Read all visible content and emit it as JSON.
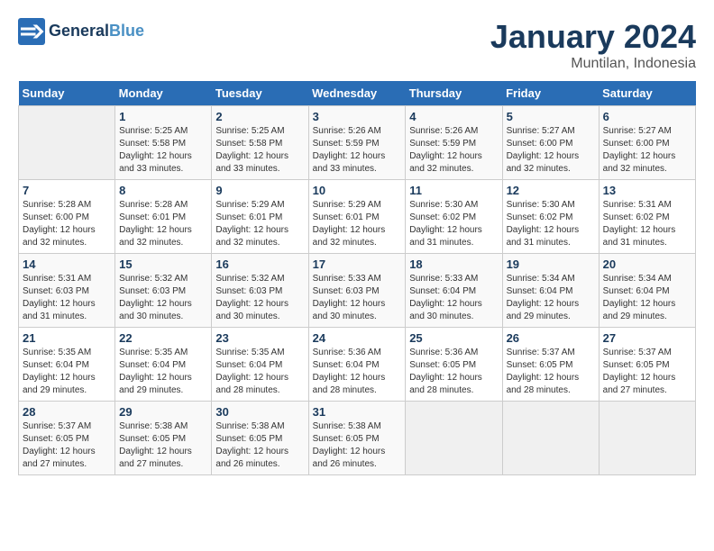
{
  "header": {
    "logo_line1": "General",
    "logo_line2": "Blue",
    "month_title": "January 2024",
    "location": "Muntilan, Indonesia"
  },
  "days_of_week": [
    "Sunday",
    "Monday",
    "Tuesday",
    "Wednesday",
    "Thursday",
    "Friday",
    "Saturday"
  ],
  "weeks": [
    [
      {
        "day": "",
        "sunrise": "",
        "sunset": "",
        "daylight": ""
      },
      {
        "day": "1",
        "sunrise": "5:25 AM",
        "sunset": "5:58 PM",
        "daylight": "12 hours and 33 minutes."
      },
      {
        "day": "2",
        "sunrise": "5:25 AM",
        "sunset": "5:58 PM",
        "daylight": "12 hours and 33 minutes."
      },
      {
        "day": "3",
        "sunrise": "5:26 AM",
        "sunset": "5:59 PM",
        "daylight": "12 hours and 33 minutes."
      },
      {
        "day": "4",
        "sunrise": "5:26 AM",
        "sunset": "5:59 PM",
        "daylight": "12 hours and 32 minutes."
      },
      {
        "day": "5",
        "sunrise": "5:27 AM",
        "sunset": "6:00 PM",
        "daylight": "12 hours and 32 minutes."
      },
      {
        "day": "6",
        "sunrise": "5:27 AM",
        "sunset": "6:00 PM",
        "daylight": "12 hours and 32 minutes."
      }
    ],
    [
      {
        "day": "7",
        "sunrise": "5:28 AM",
        "sunset": "6:00 PM",
        "daylight": "12 hours and 32 minutes."
      },
      {
        "day": "8",
        "sunrise": "5:28 AM",
        "sunset": "6:01 PM",
        "daylight": "12 hours and 32 minutes."
      },
      {
        "day": "9",
        "sunrise": "5:29 AM",
        "sunset": "6:01 PM",
        "daylight": "12 hours and 32 minutes."
      },
      {
        "day": "10",
        "sunrise": "5:29 AM",
        "sunset": "6:01 PM",
        "daylight": "12 hours and 32 minutes."
      },
      {
        "day": "11",
        "sunrise": "5:30 AM",
        "sunset": "6:02 PM",
        "daylight": "12 hours and 31 minutes."
      },
      {
        "day": "12",
        "sunrise": "5:30 AM",
        "sunset": "6:02 PM",
        "daylight": "12 hours and 31 minutes."
      },
      {
        "day": "13",
        "sunrise": "5:31 AM",
        "sunset": "6:02 PM",
        "daylight": "12 hours and 31 minutes."
      }
    ],
    [
      {
        "day": "14",
        "sunrise": "5:31 AM",
        "sunset": "6:03 PM",
        "daylight": "12 hours and 31 minutes."
      },
      {
        "day": "15",
        "sunrise": "5:32 AM",
        "sunset": "6:03 PM",
        "daylight": "12 hours and 30 minutes."
      },
      {
        "day": "16",
        "sunrise": "5:32 AM",
        "sunset": "6:03 PM",
        "daylight": "12 hours and 30 minutes."
      },
      {
        "day": "17",
        "sunrise": "5:33 AM",
        "sunset": "6:03 PM",
        "daylight": "12 hours and 30 minutes."
      },
      {
        "day": "18",
        "sunrise": "5:33 AM",
        "sunset": "6:04 PM",
        "daylight": "12 hours and 30 minutes."
      },
      {
        "day": "19",
        "sunrise": "5:34 AM",
        "sunset": "6:04 PM",
        "daylight": "12 hours and 29 minutes."
      },
      {
        "day": "20",
        "sunrise": "5:34 AM",
        "sunset": "6:04 PM",
        "daylight": "12 hours and 29 minutes."
      }
    ],
    [
      {
        "day": "21",
        "sunrise": "5:35 AM",
        "sunset": "6:04 PM",
        "daylight": "12 hours and 29 minutes."
      },
      {
        "day": "22",
        "sunrise": "5:35 AM",
        "sunset": "6:04 PM",
        "daylight": "12 hours and 29 minutes."
      },
      {
        "day": "23",
        "sunrise": "5:35 AM",
        "sunset": "6:04 PM",
        "daylight": "12 hours and 28 minutes."
      },
      {
        "day": "24",
        "sunrise": "5:36 AM",
        "sunset": "6:04 PM",
        "daylight": "12 hours and 28 minutes."
      },
      {
        "day": "25",
        "sunrise": "5:36 AM",
        "sunset": "6:05 PM",
        "daylight": "12 hours and 28 minutes."
      },
      {
        "day": "26",
        "sunrise": "5:37 AM",
        "sunset": "6:05 PM",
        "daylight": "12 hours and 28 minutes."
      },
      {
        "day": "27",
        "sunrise": "5:37 AM",
        "sunset": "6:05 PM",
        "daylight": "12 hours and 27 minutes."
      }
    ],
    [
      {
        "day": "28",
        "sunrise": "5:37 AM",
        "sunset": "6:05 PM",
        "daylight": "12 hours and 27 minutes."
      },
      {
        "day": "29",
        "sunrise": "5:38 AM",
        "sunset": "6:05 PM",
        "daylight": "12 hours and 27 minutes."
      },
      {
        "day": "30",
        "sunrise": "5:38 AM",
        "sunset": "6:05 PM",
        "daylight": "12 hours and 26 minutes."
      },
      {
        "day": "31",
        "sunrise": "5:38 AM",
        "sunset": "6:05 PM",
        "daylight": "12 hours and 26 minutes."
      },
      {
        "day": "",
        "sunrise": "",
        "sunset": "",
        "daylight": ""
      },
      {
        "day": "",
        "sunrise": "",
        "sunset": "",
        "daylight": ""
      },
      {
        "day": "",
        "sunrise": "",
        "sunset": "",
        "daylight": ""
      }
    ]
  ]
}
